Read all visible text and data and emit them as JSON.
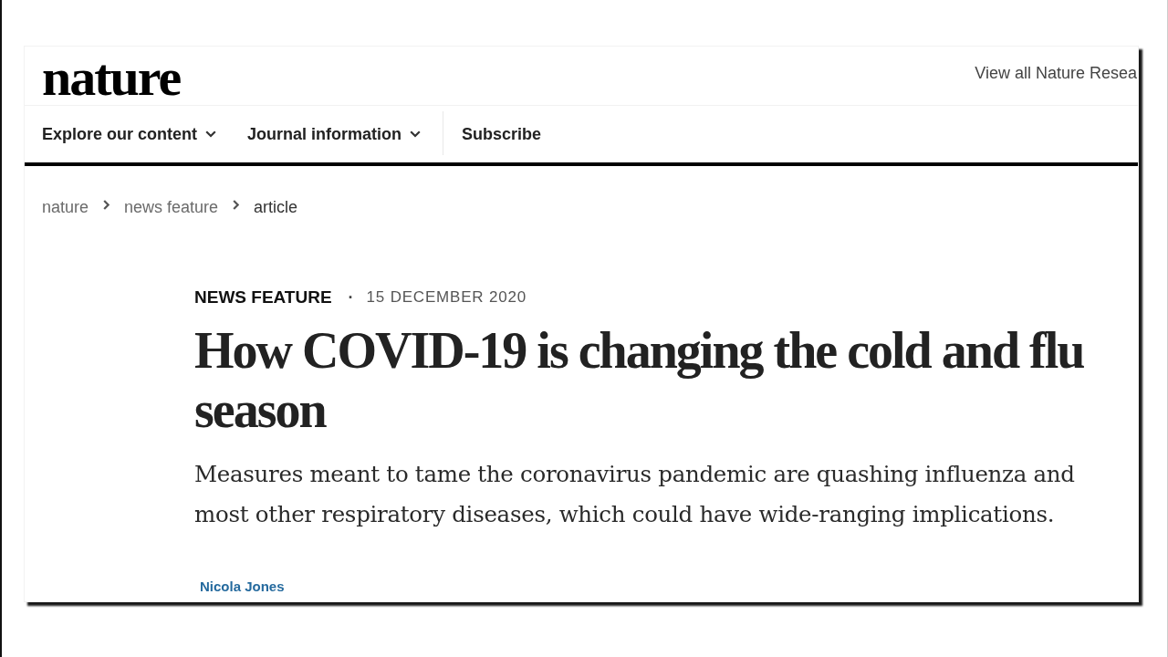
{
  "header": {
    "logo": "nature",
    "top_link": "View all Nature Resea"
  },
  "nav": {
    "items": [
      {
        "label": "Explore our content",
        "kind": "dropdown"
      },
      {
        "label": "Journal information",
        "kind": "dropdown"
      },
      {
        "label": "Subscribe",
        "kind": "link"
      }
    ]
  },
  "breadcrumbs": [
    {
      "label": "nature",
      "current": false
    },
    {
      "label": "news feature",
      "current": false
    },
    {
      "label": "article",
      "current": true
    }
  ],
  "article": {
    "type": "NEWS FEATURE",
    "separator": "·",
    "date": "15 DECEMBER 2020",
    "title": "How COVID-19 is changing the cold and flu season",
    "standfirst": "Measures meant to tame the coronavirus pandemic are quashing influenza and most other respiratory diseases, which could have wide-ranging implications.",
    "author": "Nicola Jones"
  }
}
